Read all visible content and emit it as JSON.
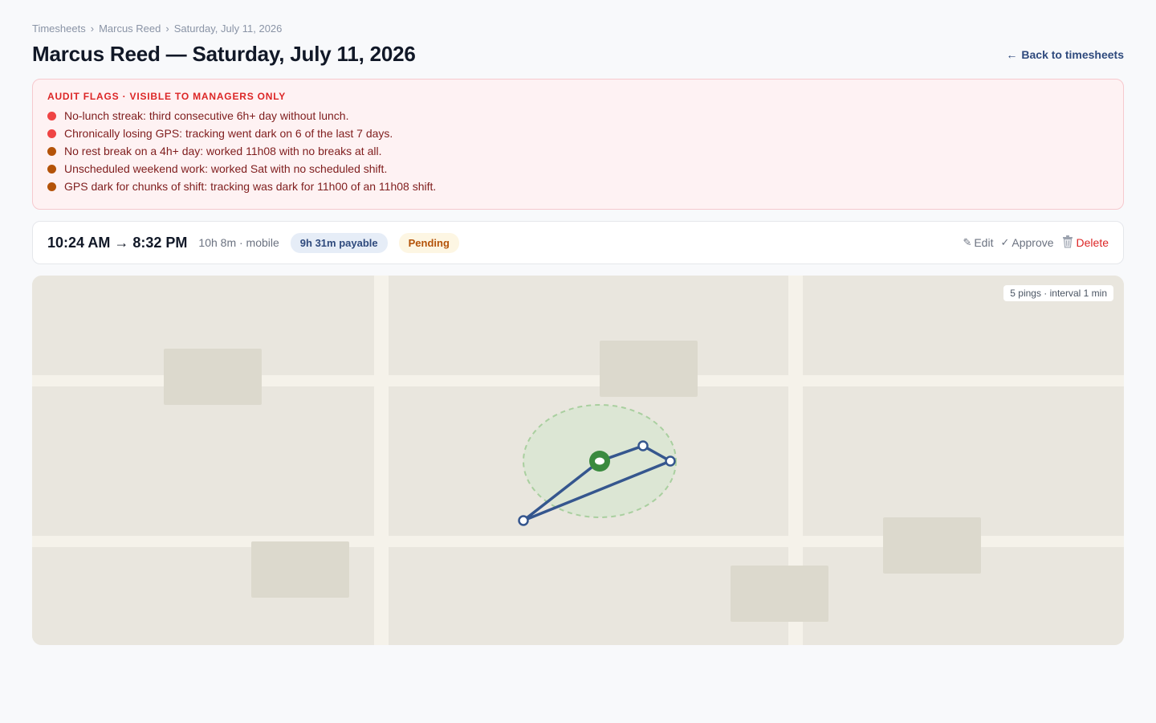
{
  "breadcrumb": {
    "items": [
      "Timesheets",
      "Marcus Reed",
      "Saturday, July 11, 2026"
    ],
    "separator": "›"
  },
  "page_title": "Marcus Reed — Saturday, July 11, 2026",
  "back_link": {
    "label": "Back to timesheets",
    "icon": "arrow-left-icon"
  },
  "audit": {
    "heading": "AUDIT FLAGS · VISIBLE TO MANAGERS ONLY",
    "flags": [
      {
        "text": "No-lunch streak: third consecutive 6h+ day without lunch.",
        "color": "#ef4444"
      },
      {
        "text": "Chronically losing GPS: tracking went dark on 6 of the last 7 days.",
        "color": "#ef4444"
      },
      {
        "text": "No rest break on a 4h+ day: worked 11h08 with no breaks at all.",
        "color": "#b45309"
      },
      {
        "text": "Unscheduled weekend work: worked Sat with no scheduled shift.",
        "color": "#b45309"
      },
      {
        "text": "GPS dark for chunks of shift: tracking was dark for 11h00 of an 11h08 shift.",
        "color": "#b45309"
      }
    ]
  },
  "shift": {
    "time_range": "10:24 AM → 8:32 PM",
    "meta": "10h 8m · mobile",
    "payable": "9h 31m payable",
    "status": "Pending",
    "actions": {
      "edit": {
        "label": "Edit",
        "icon": "pencil-icon"
      },
      "approve": {
        "label": "Approve",
        "icon": "check-icon"
      },
      "delete": {
        "label": "Delete",
        "icon": "trash-icon"
      }
    }
  },
  "map": {
    "badge": "5 pings · interval 1 min",
    "colors": {
      "land": "#e9e6de",
      "road": "#f5f2ea",
      "building": "#dcd9cd",
      "geofence_fill": "#dce6d4",
      "geofence_stroke": "#a9cf9f",
      "track": "#35568e",
      "anchor": "#3a8a3f"
    }
  }
}
